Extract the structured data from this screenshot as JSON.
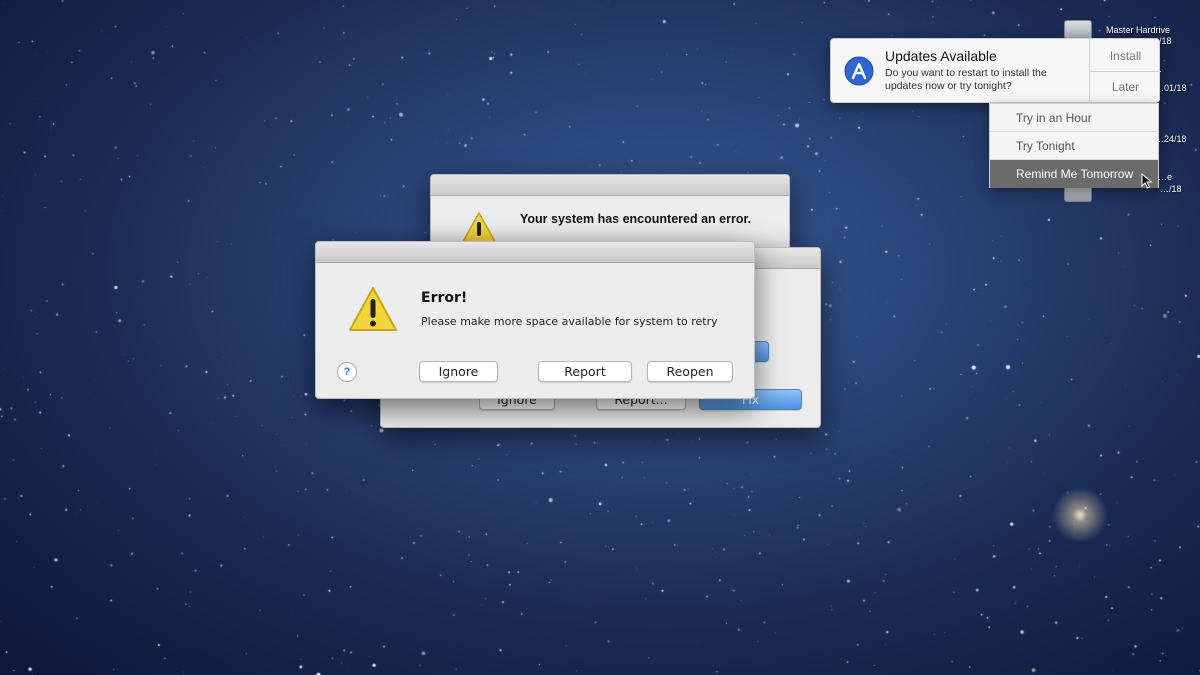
{
  "desktop": {
    "items": [
      {
        "name": "Master Hardrive",
        "date": "…/18"
      },
      {
        "date": "…01/18"
      },
      {
        "date": "…24/18"
      },
      {
        "name": "…e",
        "date": "…/18"
      }
    ]
  },
  "back_dialog": {
    "title": "Your system has encountered an error."
  },
  "mid_dialog": {
    "buttons": {
      "ignore": "Ignore",
      "report": "Report...",
      "fix": "Fix"
    }
  },
  "front_dialog": {
    "title": "Error!",
    "message": "Please make more space available for system to retry",
    "help": "?",
    "buttons": {
      "ignore": "Ignore",
      "report": "Report",
      "reopen": "Reopen"
    }
  },
  "notification": {
    "title": "Updates Available",
    "message": "Do you want to restart to install the updates now or try tonight?",
    "install": "Install",
    "later": "Later",
    "menu": [
      "Try in an Hour",
      "Try Tonight",
      "Remind Me Tomorrow"
    ]
  },
  "colors": {
    "accent": "#3d6fd6",
    "warning": "#f2d63b"
  }
}
